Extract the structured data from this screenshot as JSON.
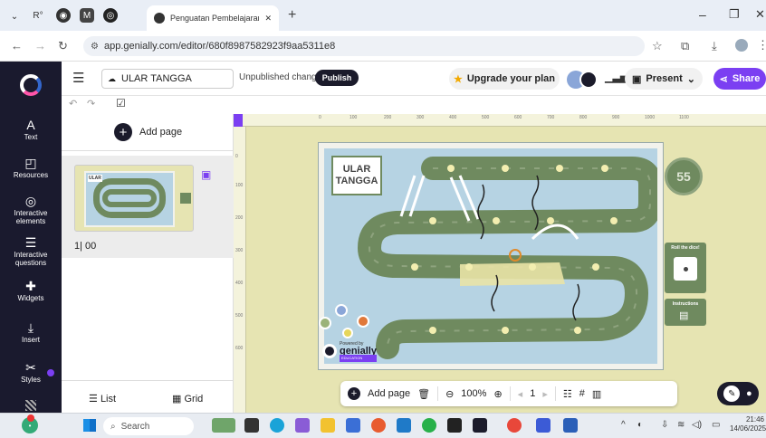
{
  "browser": {
    "tab_title": "Penguatan Pembelajaran Berba",
    "url": "app.genially.com/editor/680f8987582923f9aa5311e8",
    "tab_icon_1": "R°",
    "tab_icon_2": "M"
  },
  "rail": {
    "items": [
      {
        "label": "Text",
        "icon": "A"
      },
      {
        "label": "Resources",
        "icon": "◰"
      },
      {
        "label": "Interactive elements",
        "icon": "◎"
      },
      {
        "label": "Interactive questions",
        "icon": "☰"
      },
      {
        "label": "Widgets",
        "icon": "✚"
      },
      {
        "label": "Insert",
        "icon": "⤓"
      },
      {
        "label": "Styles",
        "icon": "✂"
      }
    ]
  },
  "appbar": {
    "title": "ULAR TANGGA",
    "status": "Unpublished changes",
    "publish": "Publish",
    "upgrade": "Upgrade your plan",
    "present": "Present",
    "share": "Share"
  },
  "pages": {
    "add_page": "Add page",
    "page_label": "1| 00",
    "list": "List",
    "grid": "Grid"
  },
  "board": {
    "title_line1": "ULAR",
    "title_line2": "TANGGA",
    "finish_number": "55",
    "roll_label": "Roll the dice!",
    "instructions_label": "Instructions",
    "powered": "Powered by",
    "brand": "genially",
    "brand_sub": "EDUCATION"
  },
  "ruler": {
    "ticks": [
      "0",
      "100",
      "200",
      "300",
      "400",
      "500",
      "600",
      "700",
      "800",
      "900",
      "1000",
      "1100"
    ],
    "vticks": [
      "0",
      "100",
      "200",
      "300",
      "400",
      "500",
      "600"
    ]
  },
  "bottombar": {
    "add_page": "Add page",
    "zoom": "100%",
    "page_number": "1"
  },
  "taskbar": {
    "search": "Search",
    "time": "21:46",
    "date": "14/06/2025"
  },
  "colors": {
    "accent": "#7b3ff2",
    "board_green": "#6f8a5f",
    "canvas_bg": "#e6e4b2"
  }
}
